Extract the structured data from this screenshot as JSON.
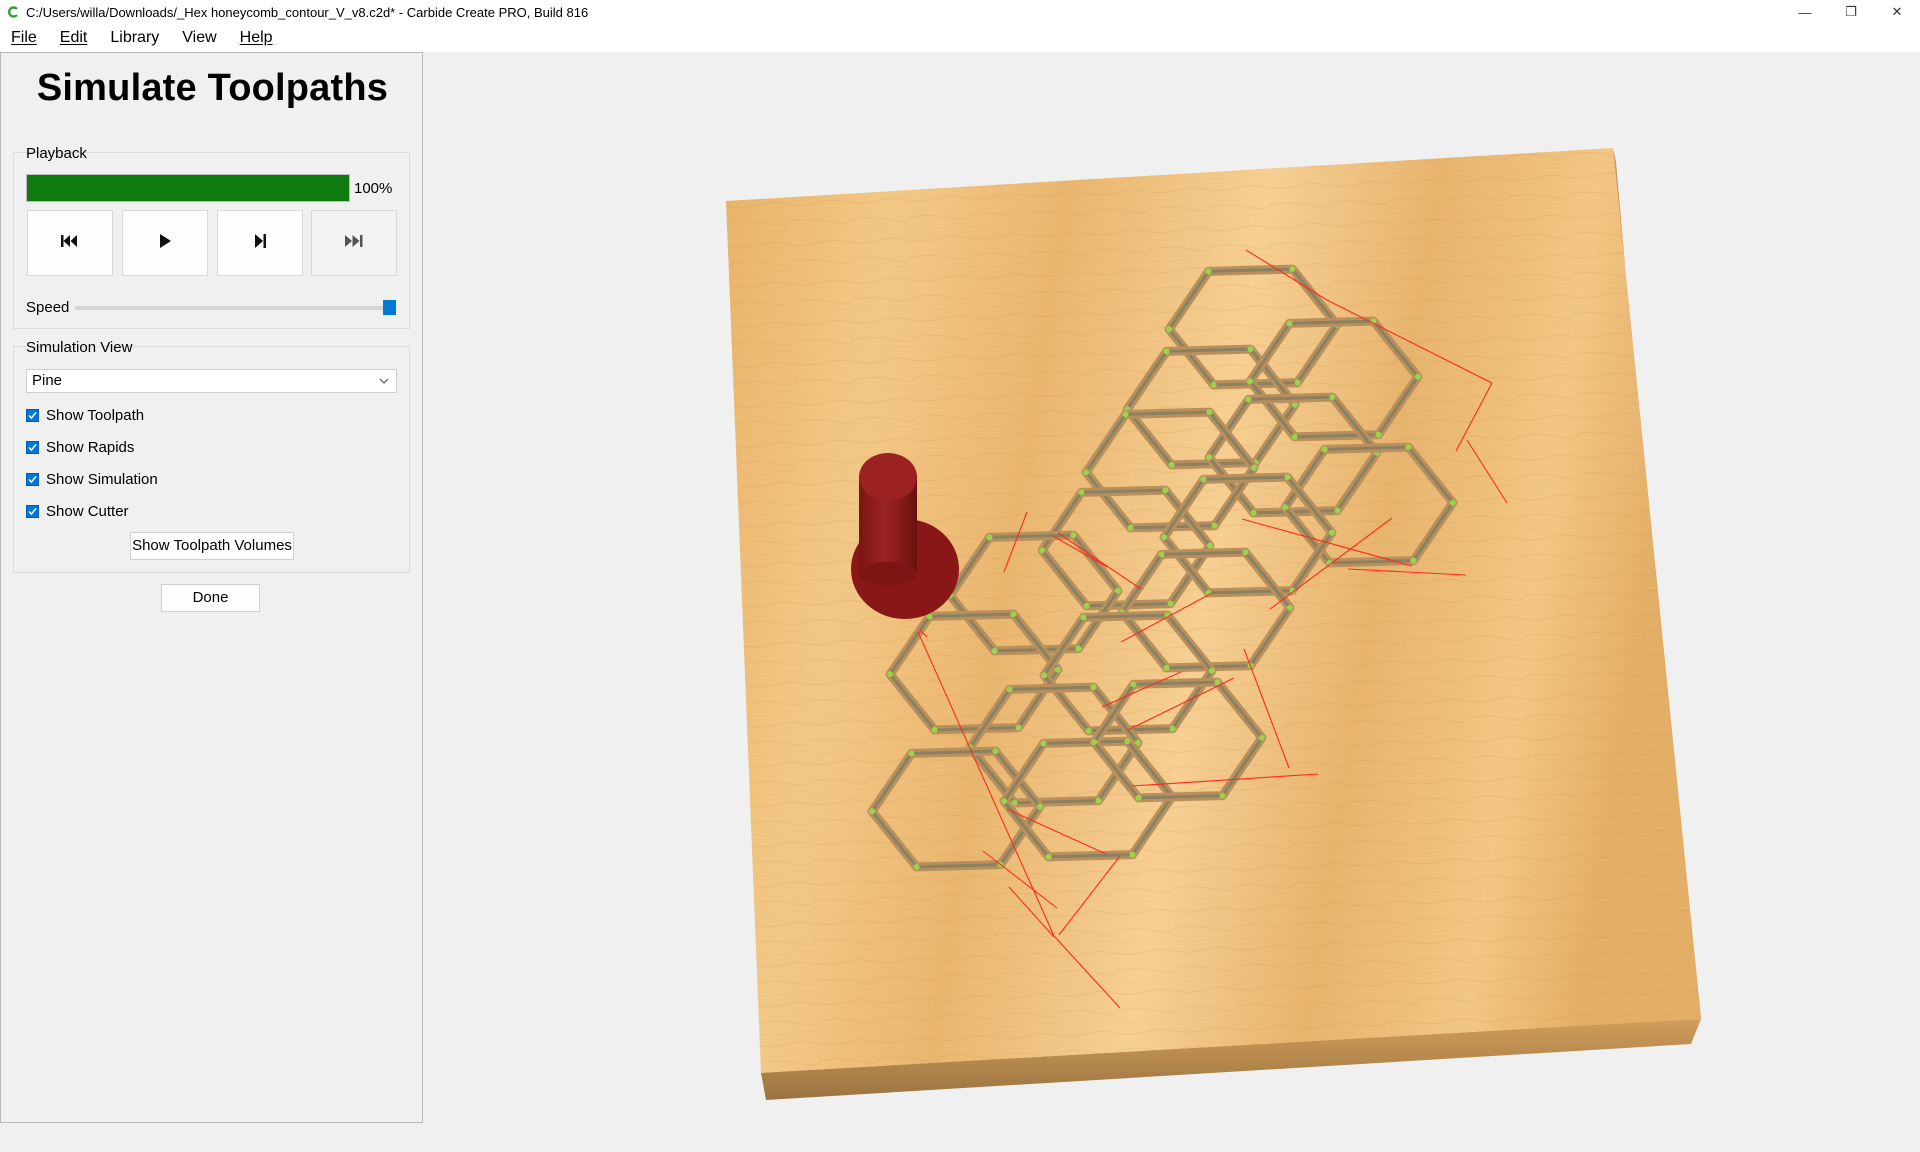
{
  "window": {
    "title": "C:/Users/willa/Downloads/_Hex honeycomb_contour_V_v8.c2d* - Carbide Create PRO, Build 816",
    "controls": {
      "minimize": "—",
      "restore": "❐",
      "close": "✕"
    }
  },
  "menu": {
    "items": [
      "File",
      "Edit",
      "Library",
      "View",
      "Help"
    ]
  },
  "panel": {
    "title": "Simulate Toolpaths",
    "playback": {
      "label": "Playback",
      "progress_percent": 100,
      "progress_text": "100%",
      "buttons": [
        {
          "name": "rewind",
          "icon": "skip-to-start-icon"
        },
        {
          "name": "play",
          "icon": "play-icon"
        },
        {
          "name": "step",
          "icon": "step-forward-icon"
        },
        {
          "name": "fast-forward",
          "icon": "skip-to-end-icon"
        }
      ]
    },
    "speed": {
      "label": "Speed",
      "value": 1.0
    },
    "simulation_view": {
      "label": "Simulation View",
      "selected": "Pine",
      "checkboxes": [
        {
          "label": "Show Toolpath",
          "checked": true
        },
        {
          "label": "Show Rapids",
          "checked": true
        },
        {
          "label": "Show Simulation",
          "checked": true
        },
        {
          "label": "Show Cutter",
          "checked": true
        }
      ],
      "volumes_button": "Show Toolpath Volumes"
    },
    "done_button": "Done"
  },
  "colors": {
    "progress": "#0f7b0f",
    "accent": "#0078d7",
    "wood": "#efc07c",
    "cutter": "#8b1a1a",
    "rapids": "#ff2a1a",
    "toolpath": "#9bd44a"
  }
}
